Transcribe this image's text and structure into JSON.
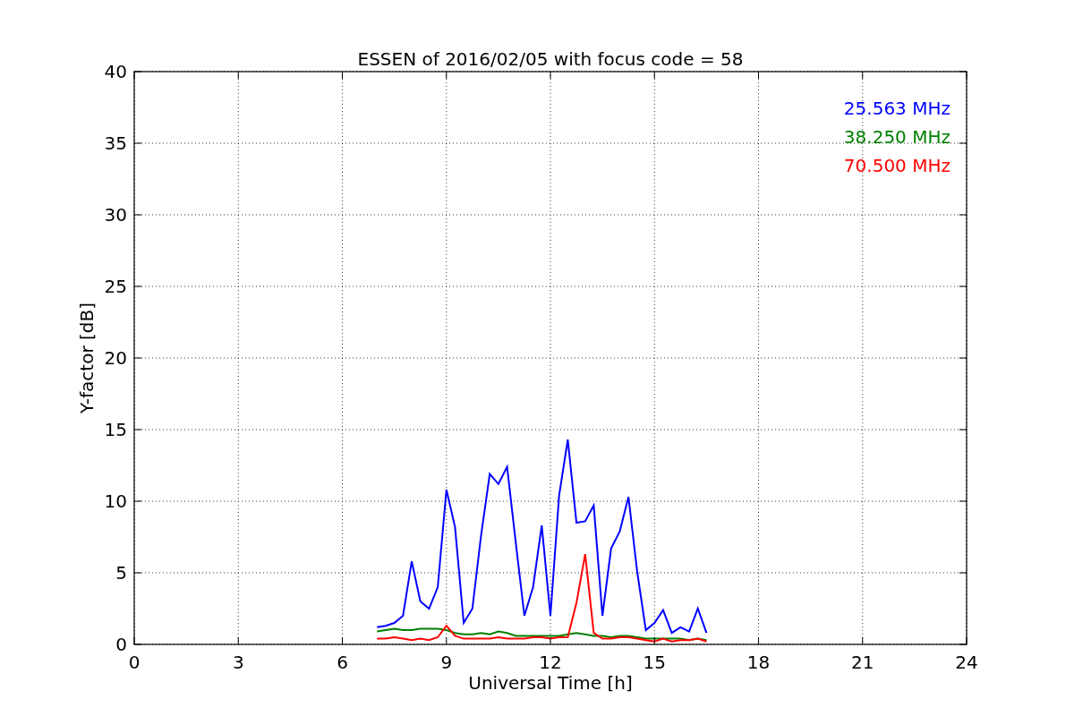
{
  "figure": {
    "chart_data": {
      "type": "line",
      "title": "ESSEN of 2016/02/05 with focus code = 58",
      "xlabel": "Universal Time [h]",
      "ylabel": "Y-factor [dB]",
      "grid": true,
      "xlim": [
        0,
        24
      ],
      "ylim": [
        0,
        40
      ],
      "xticks": [
        0,
        3,
        6,
        9,
        12,
        15,
        18,
        21,
        24
      ],
      "yticks": [
        0,
        5,
        10,
        15,
        20,
        25,
        30,
        35,
        40
      ],
      "x": [
        7,
        7.25,
        7.5,
        7.75,
        8,
        8.25,
        8.5,
        8.75,
        9,
        9.25,
        9.5,
        9.75,
        10,
        10.25,
        10.5,
        10.75,
        11,
        11.25,
        11.5,
        11.75,
        12,
        12.25,
        12.5,
        12.75,
        13,
        13.25,
        13.5,
        13.75,
        14,
        14.25,
        14.5,
        14.75,
        15,
        15.25,
        15.5,
        15.75,
        16,
        16.25,
        16.5
      ],
      "series": [
        {
          "name": "25.563 MHz",
          "color": "#0000ff",
          "values": [
            1.2,
            1.3,
            1.5,
            2,
            5.8,
            3,
            2.5,
            4,
            10.8,
            8.2,
            1.5,
            2.5,
            7.6,
            11.9,
            11.2,
            12.4,
            7.1,
            2,
            4,
            8.3,
            2,
            10.4,
            14.3,
            8.5,
            8.6,
            9.7,
            2,
            6.7,
            7.9,
            10.3,
            5.1,
            1,
            1.5,
            2.4,
            0.8,
            1.2,
            0.9,
            2.5,
            0.8
          ]
        },
        {
          "name": "38.250 MHz",
          "color": "#008000",
          "values": [
            0.9,
            1,
            1.1,
            1,
            1,
            1.1,
            1.1,
            1.1,
            1,
            0.8,
            0.7,
            0.7,
            0.8,
            0.7,
            0.9,
            0.8,
            0.6,
            0.6,
            0.6,
            0.6,
            0.6,
            0.6,
            0.7,
            0.8,
            0.7,
            0.6,
            0.6,
            0.5,
            0.6,
            0.6,
            0.5,
            0.4,
            0.4,
            0.4,
            0.4,
            0.4,
            0.3,
            0.4,
            0.3
          ]
        },
        {
          "name": "70.500 MHz",
          "color": "#ff0000",
          "values": [
            0.4,
            0.4,
            0.5,
            0.4,
            0.3,
            0.4,
            0.3,
            0.5,
            1.3,
            0.6,
            0.4,
            0.4,
            0.4,
            0.4,
            0.5,
            0.4,
            0.4,
            0.4,
            0.5,
            0.5,
            0.4,
            0.5,
            0.5,
            2.9,
            6.3,
            0.8,
            0.4,
            0.4,
            0.5,
            0.5,
            0.4,
            0.3,
            0.2,
            0.4,
            0.2,
            0.3,
            0.3,
            0.4,
            0.2
          ]
        }
      ]
    }
  }
}
